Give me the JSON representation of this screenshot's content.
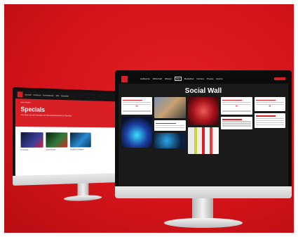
{
  "left_screen": {
    "nav": [
      "Specials",
      "Konferenz",
      "Eventkalender",
      "Jobs",
      "Newsletter"
    ],
    "breadcrumb": "Heise Medien",
    "title": "Specials",
    "subtitle": "Hier finden Sie alle Specials und Themenschwerpunkte im Überblick.",
    "cards": [
      {
        "caption": "IT-Security",
        "color": "#1f2f6b"
      },
      {
        "caption": "Cloud-Dienste",
        "color": "#234d2a"
      },
      {
        "caption": "Künstliche Intelligenz",
        "color": "#1b5a8a"
      }
    ]
  },
  "right_screen": {
    "nav": [
      "Heilberufe",
      "Wirtschaft",
      "Wissen",
      "Wall",
      "Mediathek",
      "Karriere",
      "Presse",
      "Events"
    ],
    "title": "Social Wall",
    "quote_glyph": "❝"
  }
}
